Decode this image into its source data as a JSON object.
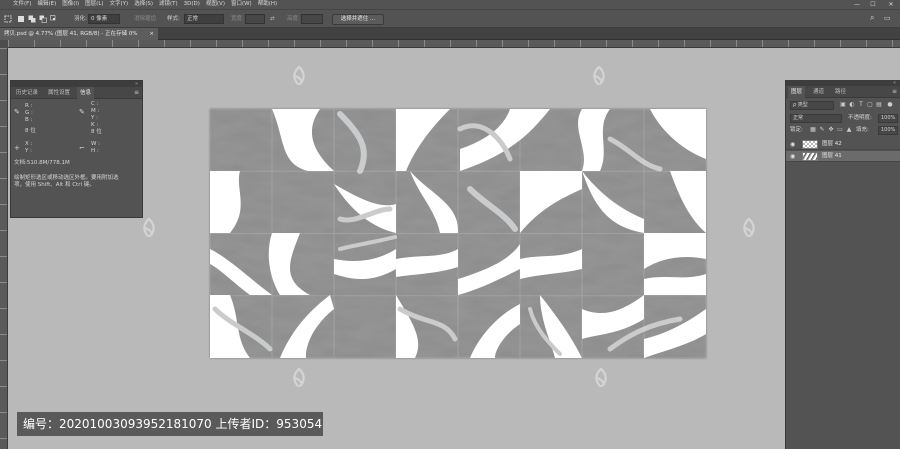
{
  "menu": [
    "文件(F)",
    "编辑(E)",
    "图像(I)",
    "图层(L)",
    "文字(Y)",
    "选择(S)",
    "滤镜(T)",
    "3D(D)",
    "视图(V)",
    "窗口(W)",
    "帮助(H)"
  ],
  "window_controls": {
    "minimize": "—",
    "maximize": "☐",
    "close": "✕"
  },
  "options_bar": {
    "feather_label": "羽化:",
    "feather_value": "0 像素",
    "antialias_label": "消除锯齿",
    "style_label": "样式:",
    "style_value": "正常",
    "width_label": "宽度:",
    "height_label": "高度:",
    "swap_icon": "⇄",
    "select_mask_button": "选择并遮住 ...",
    "search_icon": "⌕",
    "workspace_icon": "▭"
  },
  "document_tab": {
    "title": "拷贝.psd @ 4.77% (图层 41, RGB/8) - 正在存储 0%",
    "close": "×"
  },
  "info_panel": {
    "collapse": "»",
    "tabs": [
      "历史记录",
      "属性设置",
      "信息"
    ],
    "active_tab": 2,
    "menu_icon": "≡",
    "left_rgb": [
      "R :",
      "G :",
      "B :"
    ],
    "left_bit": "8 位",
    "right_cmyk": [
      "C :",
      "M :",
      "Y :",
      "K :"
    ],
    "right_bit": "8 位",
    "xy": [
      "X :",
      "Y :"
    ],
    "wh": [
      "W :",
      "H :"
    ],
    "doc_size": "文档:510.8M/778.1M",
    "hint_line1": "绘制矩形选区或移动选区外框。要用附加选",
    "hint_line2": "项，使用 Shift、Alt 和 Ctrl 键。"
  },
  "layers_panel": {
    "collapse": "«",
    "tabs": [
      "图层",
      "通道",
      "路径"
    ],
    "active_tab": 0,
    "menu_icon": "≡",
    "filter_label": "ρ 类型",
    "blend_mode": "正常",
    "opacity_label": "不透明度:",
    "opacity_value": "100%",
    "lock_label": "锁定:",
    "fill_label": "填充:",
    "fill_value": "100%",
    "layers": [
      {
        "name": "图层 42",
        "selected": false
      },
      {
        "name": "图层 41",
        "selected": true
      }
    ]
  },
  "watermark_caption": "编号：20201003093952181070 上传者ID：953054",
  "colors": {
    "ui_dark": "#535353",
    "canvas_bg": "#b9b9b9",
    "marble_dark": "#5e5e5e",
    "marble_mid": "#8f8f8f",
    "stripe_light": "#c9cbcd"
  }
}
